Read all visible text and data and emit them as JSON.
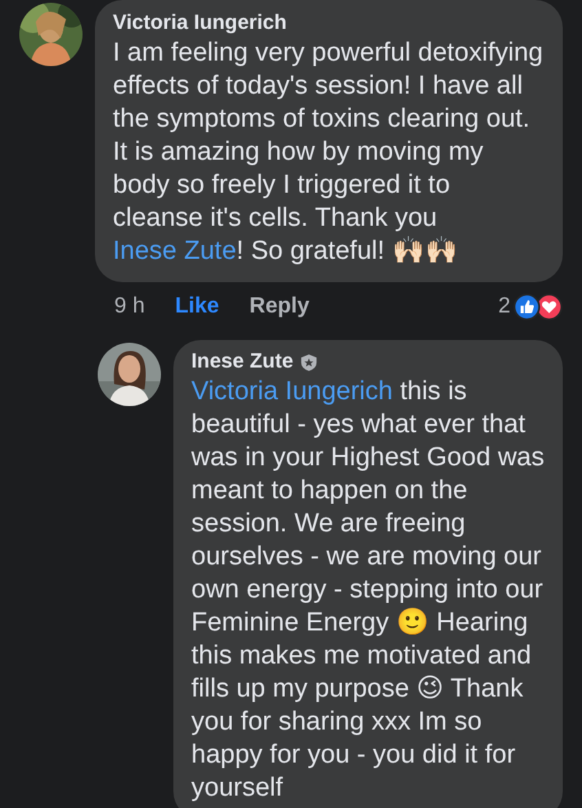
{
  "comments": [
    {
      "author": "Victoria Iungerich",
      "badge": false,
      "body": [
        {
          "kind": "text",
          "text": "I am feeling very powerful detoxifying effects of today's session! I have all the symptoms of toxins clearing out. It is amazing how by moving my body so freely I triggered it to cleanse it's cells. Thank you "
        },
        {
          "kind": "mention",
          "text": "Inese Zute"
        },
        {
          "kind": "text",
          "text": "! So grateful! 🙌🏻🙌🏻"
        }
      ],
      "time": "9 h",
      "like": {
        "label": "Like",
        "selected": true
      },
      "reply": "Reply",
      "reaction_count": "2"
    },
    {
      "author": "Inese Zute",
      "badge": true,
      "body": [
        {
          "kind": "mention",
          "text": "Victoria Iungerich"
        },
        {
          "kind": "text",
          "text": " this is beautiful - yes what ever that was in your Highest Good was meant to happen on the session. We are freeing ourselves - we are moving our own energy - stepping into our Feminine Energy 🙂  Hearing this makes me motivated and fills up my purpose 😉 Thank you for sharing xxx Im so happy for you - you did it for yourself"
        }
      ]
    }
  ]
}
